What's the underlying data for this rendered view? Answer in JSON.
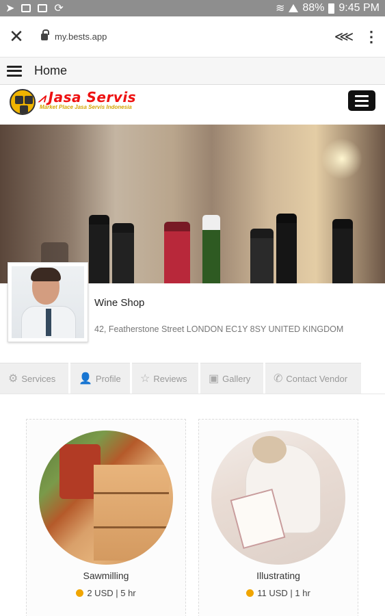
{
  "status_bar": {
    "battery": "88%",
    "time": "9:45 PM"
  },
  "browser": {
    "url": "my.bests.app",
    "close_icon": "close-icon",
    "lock_icon": "lock-icon",
    "share_icon": "share-icon",
    "more_icon": "more-vert-icon"
  },
  "home_bar": {
    "title": "Home"
  },
  "site": {
    "logo_title": "Jasa Servis",
    "logo_tagline": "Market Place Jasa Servis Indonesia",
    "accent_color": "#e11111"
  },
  "vendor": {
    "name": "Wine Shop",
    "address": "42, Featherstone Street LONDON EC1Y 8SY UNITED KINGDOM"
  },
  "tabs": [
    {
      "label": "Services",
      "icon": "gear-icon"
    },
    {
      "label": "Profile",
      "icon": "user-icon"
    },
    {
      "label": "Reviews",
      "icon": "star-icon"
    },
    {
      "label": "Gallery",
      "icon": "image-icon"
    },
    {
      "label": "Contact Vendor",
      "icon": "phone-icon"
    }
  ],
  "services": [
    {
      "name": "Sawmilling",
      "price": "2 USD | 5 hr"
    },
    {
      "name": "Illustrating",
      "price": "11 USD | 1 hr"
    }
  ]
}
